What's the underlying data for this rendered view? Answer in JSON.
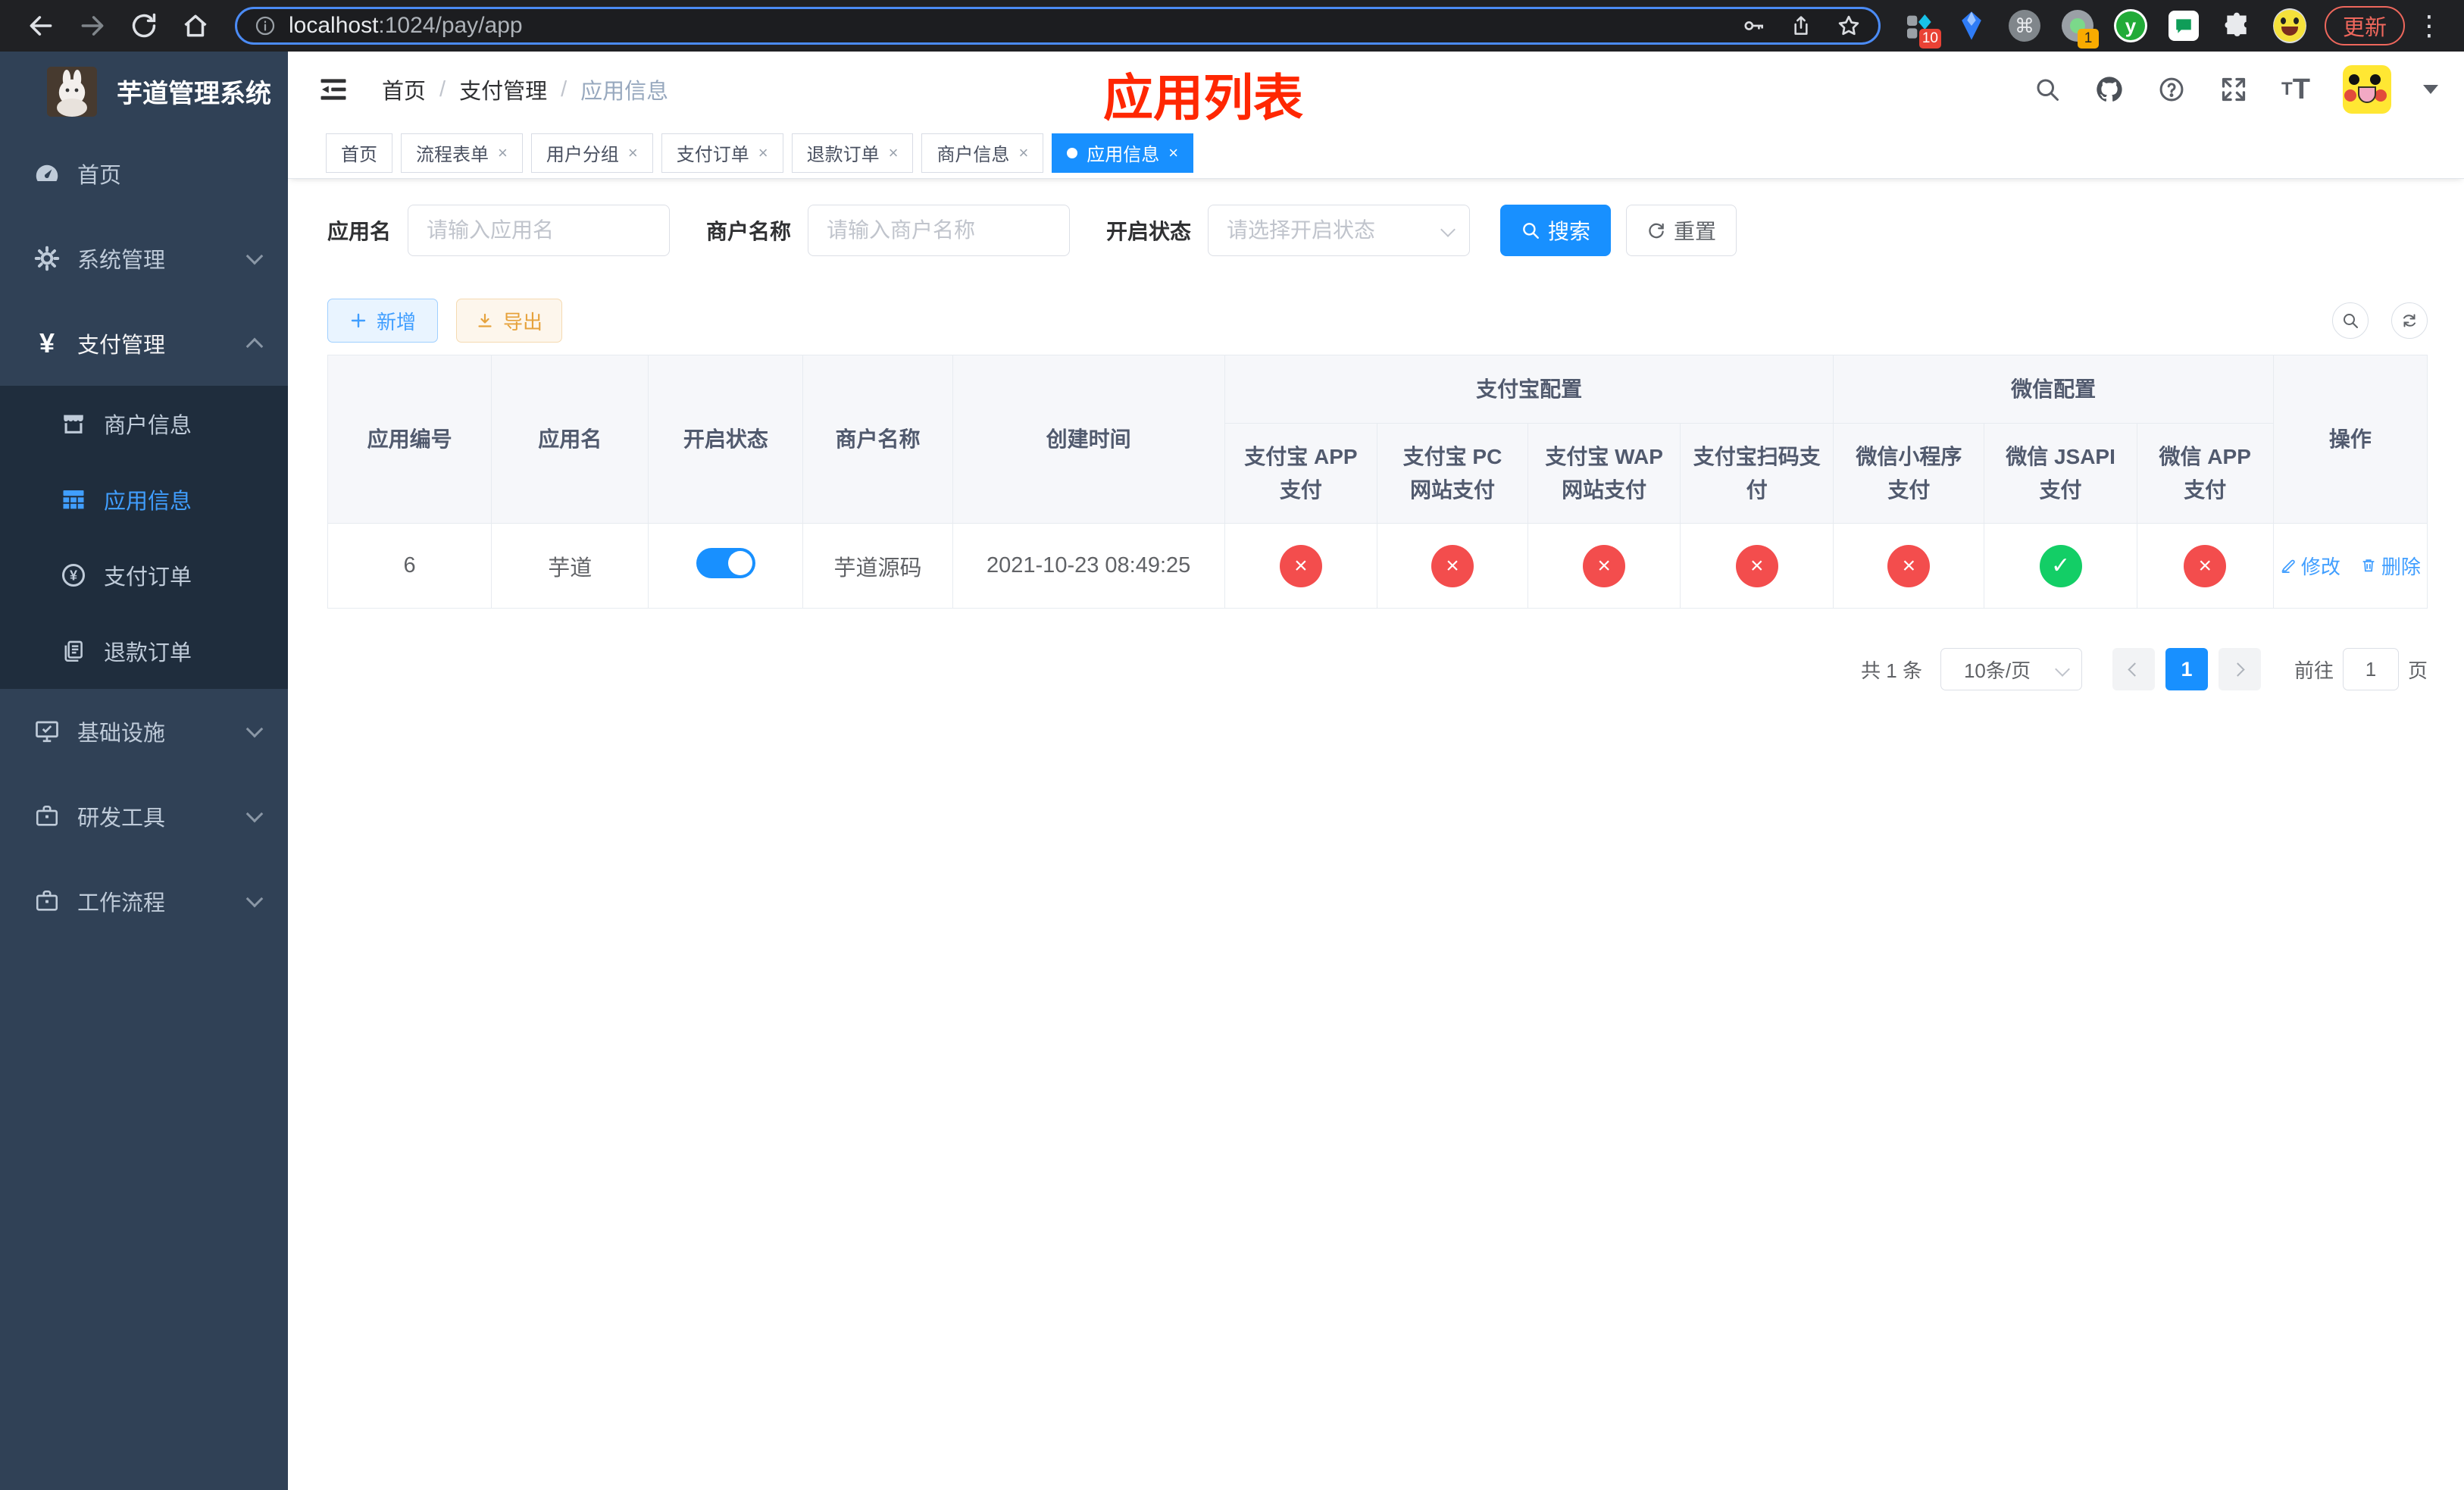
{
  "browser": {
    "url_host": "localhost",
    "url_path": ":1024/pay/app",
    "update_label": "更新",
    "ext_badge_ten": "10",
    "ext_badge_one": "1",
    "ext_letter": "y"
  },
  "colors": {
    "primary": "#1890ff",
    "link": "#409eff",
    "success": "#13ce66",
    "danger": "#f34d4d",
    "annotation_red": "#ff2702",
    "sidebar_bg": "#304156",
    "submenu_bg": "#1f2d3d",
    "warning": "#e6a23c"
  },
  "sidebar": {
    "title": "芋道管理系统",
    "items": [
      {
        "label": "首页"
      },
      {
        "label": "系统管理"
      },
      {
        "label": "支付管理"
      },
      {
        "label": "基础设施"
      },
      {
        "label": "研发工具"
      },
      {
        "label": "工作流程"
      }
    ],
    "pay_submenu": [
      {
        "label": "商户信息"
      },
      {
        "label": "应用信息"
      },
      {
        "label": "支付订单"
      },
      {
        "label": "退款订单"
      }
    ]
  },
  "header": {
    "breadcrumb": [
      "首页",
      "支付管理",
      "应用信息"
    ],
    "annotation": "应用列表"
  },
  "tabs": [
    {
      "label": "首页"
    },
    {
      "label": "流程表单"
    },
    {
      "label": "用户分组"
    },
    {
      "label": "支付订单"
    },
    {
      "label": "退款订单"
    },
    {
      "label": "商户信息"
    },
    {
      "label": "应用信息"
    }
  ],
  "filters": {
    "app_name_label": "应用名",
    "app_name_placeholder": "请输入应用名",
    "merchant_label": "商户名称",
    "merchant_placeholder": "请输入商户名称",
    "status_label": "开启状态",
    "status_placeholder": "请选择开启状态",
    "search_label": "搜索",
    "reset_label": "重置"
  },
  "toolbar": {
    "add_label": "新增",
    "export_label": "导出"
  },
  "table": {
    "columns": {
      "app_id": "应用编号",
      "app_name": "应用名",
      "status": "开启状态",
      "merchant": "商户名称",
      "created": "创建时间",
      "alipay_group": "支付宝配置",
      "wechat_group": "微信配置",
      "actions": "操作",
      "sub": [
        "支付宝 APP 支付",
        "支付宝 PC 网站支付",
        "支付宝 WAP 网站支付",
        "支付宝扫码支付",
        "微信小程序支付",
        "微信 JSAPI 支付",
        "微信 APP 支付"
      ]
    },
    "row": {
      "app_id": "6",
      "app_name": "芋道",
      "enabled": true,
      "merchant": "芋道源码",
      "created": "2021-10-23 08:49:25",
      "configs": [
        "no",
        "no",
        "no",
        "no",
        "no",
        "yes",
        "no"
      ],
      "edit_label": "修改",
      "delete_label": "删除"
    }
  },
  "pagination": {
    "total": "共 1 条",
    "per_page": "10条/页",
    "current_page": "1",
    "goto_label": "前往",
    "goto_value": "1",
    "unit_label": "页"
  }
}
